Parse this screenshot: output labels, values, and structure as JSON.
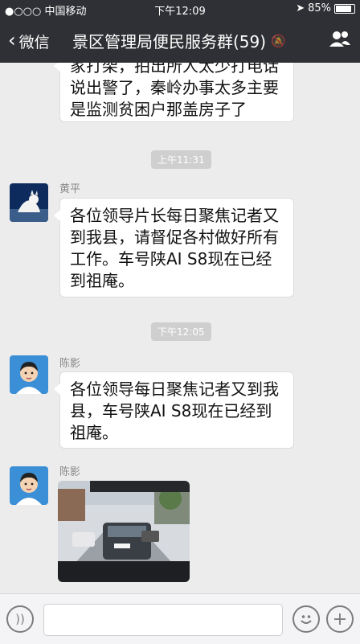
{
  "status": {
    "carrier": "●○○○ 中国移动",
    "time": "下午12:09",
    "battery": "85%"
  },
  "nav": {
    "back_label": "微信",
    "title": "景区管理局便民服务群(59)"
  },
  "messages": [
    {
      "type": "text",
      "text": "家打架，拍出所人太少打电话说出警了，秦岭办事太多主要是监测贫困户那盖房子了"
    },
    {
      "type": "timestamp",
      "text": "上午11:31"
    },
    {
      "type": "text",
      "sender": "黄平",
      "text": "各位领导片长每日聚焦记者又到我县，请督促各村做好所有工作。车号陕AI S8现在已经到祖庵。"
    },
    {
      "type": "timestamp",
      "text": "下午12:05"
    },
    {
      "type": "text",
      "sender": "陈影",
      "text": "各位领导每日聚焦记者又到我县，车号陕AI S8现在已经到祖庵。"
    },
    {
      "type": "image",
      "sender": "陈影"
    }
  ],
  "colors": {
    "nav_bg": "#2f3035",
    "chat_bg": "#ececec",
    "bubble_bg": "#ffffff"
  }
}
